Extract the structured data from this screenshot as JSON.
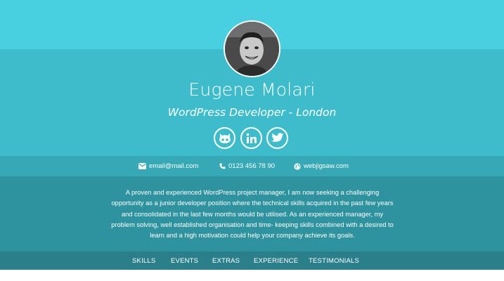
{
  "profile": {
    "name": "Eugene Molari",
    "title": "WordPress Developer - London"
  },
  "socials": [
    {
      "icon": "github-icon",
      "label": "GitHub"
    },
    {
      "icon": "linkedin-icon",
      "label": "LinkedIn"
    },
    {
      "icon": "twitter-icon",
      "label": "Twitter"
    }
  ],
  "contact": {
    "email": "email@mail.com",
    "phone": "0123 456 78 90",
    "website": "webjigsaw.com"
  },
  "about": {
    "text": "A proven and experienced WordPress project manager, I am now seeking a challenging opportunity as a junior developer position where the technical skills acquired in the past few years and consolidated in the last few months would be utilised. As an experienced manager, my problem solving, well established organisation and time- keeping skills combined with a desired to learn and a high motivation could help your company achieve its goals."
  },
  "nav": {
    "items": [
      "SKILLS",
      "EVENTS",
      "EXTRAS",
      "EXPERIENCE",
      "TESTIMONIALS"
    ]
  },
  "colors": {
    "band_top": "#48cfe0",
    "band_hero": "#3fbccc",
    "band_contact": "#37a8b6",
    "band_about": "#2e929f",
    "band_nav": "#2a7f8a"
  }
}
